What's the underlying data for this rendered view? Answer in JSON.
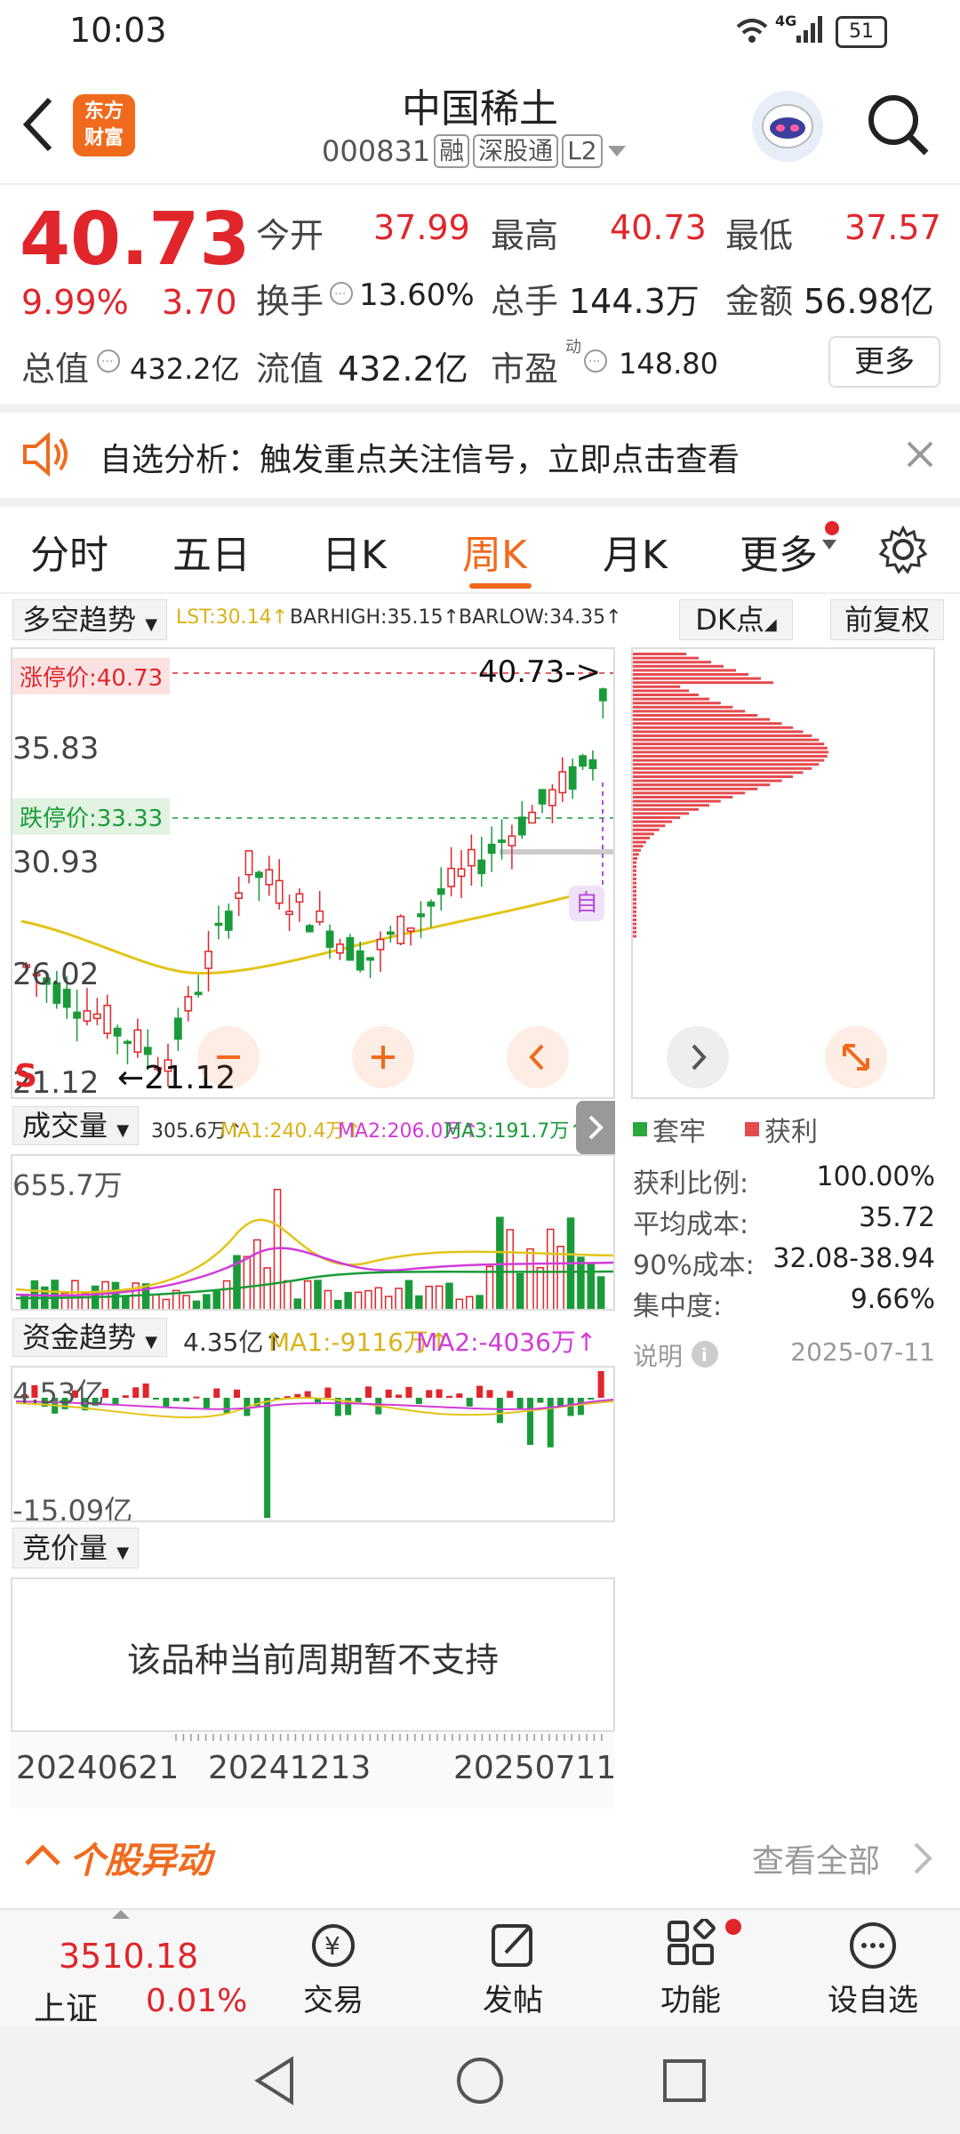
{
  "status_bar": {
    "time": "10:03",
    "network": "4G",
    "battery": "51"
  },
  "header": {
    "logo_line1": "东方",
    "logo_line2": "财富",
    "title": "中国稀土",
    "code": "000831",
    "tags": [
      "融",
      "深股通",
      "L2"
    ]
  },
  "quote": {
    "price": "40.73",
    "change_pct": "9.99%",
    "change": "3.70",
    "open_label": "今开",
    "open": "37.99",
    "high_label": "最高",
    "high": "40.73",
    "low_label": "最低",
    "low": "37.57",
    "turnover_label": "换手",
    "turnover": "13.60%",
    "volume_label": "总手",
    "volume": "144.3万",
    "amount_label": "金额",
    "amount": "56.98亿",
    "mktcap_label": "总值",
    "mktcap": "432.2亿",
    "float_label": "流值",
    "float": "432.2亿",
    "pe_label": "市盈",
    "pe_sup": "动",
    "pe": "148.80",
    "more_button": "更多"
  },
  "banner": {
    "text": "自选分析：触发重点关注信号，立即点击查看"
  },
  "tabs": [
    {
      "label": "分时",
      "active": false
    },
    {
      "label": "五日",
      "active": false
    },
    {
      "label": "日K",
      "active": false
    },
    {
      "label": "周K",
      "active": true
    },
    {
      "label": "月K",
      "active": false
    },
    {
      "label": "更多",
      "active": false
    }
  ],
  "indicator_bar": {
    "selector": "多空趋势",
    "lst": "LST:30.14↑",
    "barhigh": "BARHIGH:35.15↑",
    "barlow": "BARLOW:34.35↑",
    "dk_button": "DK点",
    "adjust_button": "前复权"
  },
  "main_chart": {
    "limit_up_label": "涨停价:40.73",
    "limit_down_label": "跌停价:33.33",
    "y_ticks": [
      "35.83",
      "30.93",
      "26.02",
      "21.12"
    ],
    "last_price_marker": "40.73->",
    "low_marker": "←21.12",
    "s_marker": "S",
    "self_marker": "自"
  },
  "volume_bar": {
    "selector": "成交量",
    "v": "305.6万↑",
    "ma1": "MA1:240.4万↑",
    "ma2": "MA2:206.0万↑",
    "ma3": "MA3:191.7万↑",
    "y_top": "655.7万"
  },
  "fund_bar": {
    "selector": "资金趋势",
    "v": "4.35亿↑",
    "ma1": "MA1:-9116万↑",
    "ma2": "MA2:-4036万↑",
    "y_top": "4.53亿",
    "y_bottom": "-15.09亿"
  },
  "auction": {
    "selector": "竞价量",
    "empty_text": "该品种当前周期暂不支持"
  },
  "dates": [
    "20240621",
    "20241213",
    "20250711"
  ],
  "chip_panel": {
    "legend_trapped": "套牢",
    "legend_profit": "获利",
    "rows": [
      {
        "label": "获利比例:",
        "value": "100.00%"
      },
      {
        "label": "平均成本:",
        "value": "35.72"
      },
      {
        "label": "90%成本:",
        "value": "32.08-38.94"
      },
      {
        "label": "集中度:",
        "value": "9.66%"
      }
    ],
    "note_label": "说明",
    "note_date": "2025-07-11"
  },
  "movement": {
    "title": "个股异动",
    "view_all": "查看全部"
  },
  "bottom_nav": {
    "index_value": "3510.18",
    "index_name": "上证",
    "index_change": "0.01%",
    "items": [
      "交易",
      "发帖",
      "功能",
      "设自选"
    ]
  },
  "colors": {
    "up": "#e0262b",
    "down": "#1a9b3a",
    "accent": "#f06a1d",
    "ma_yellow": "#e9c21a",
    "ma_magenta": "#d13bd8"
  }
}
